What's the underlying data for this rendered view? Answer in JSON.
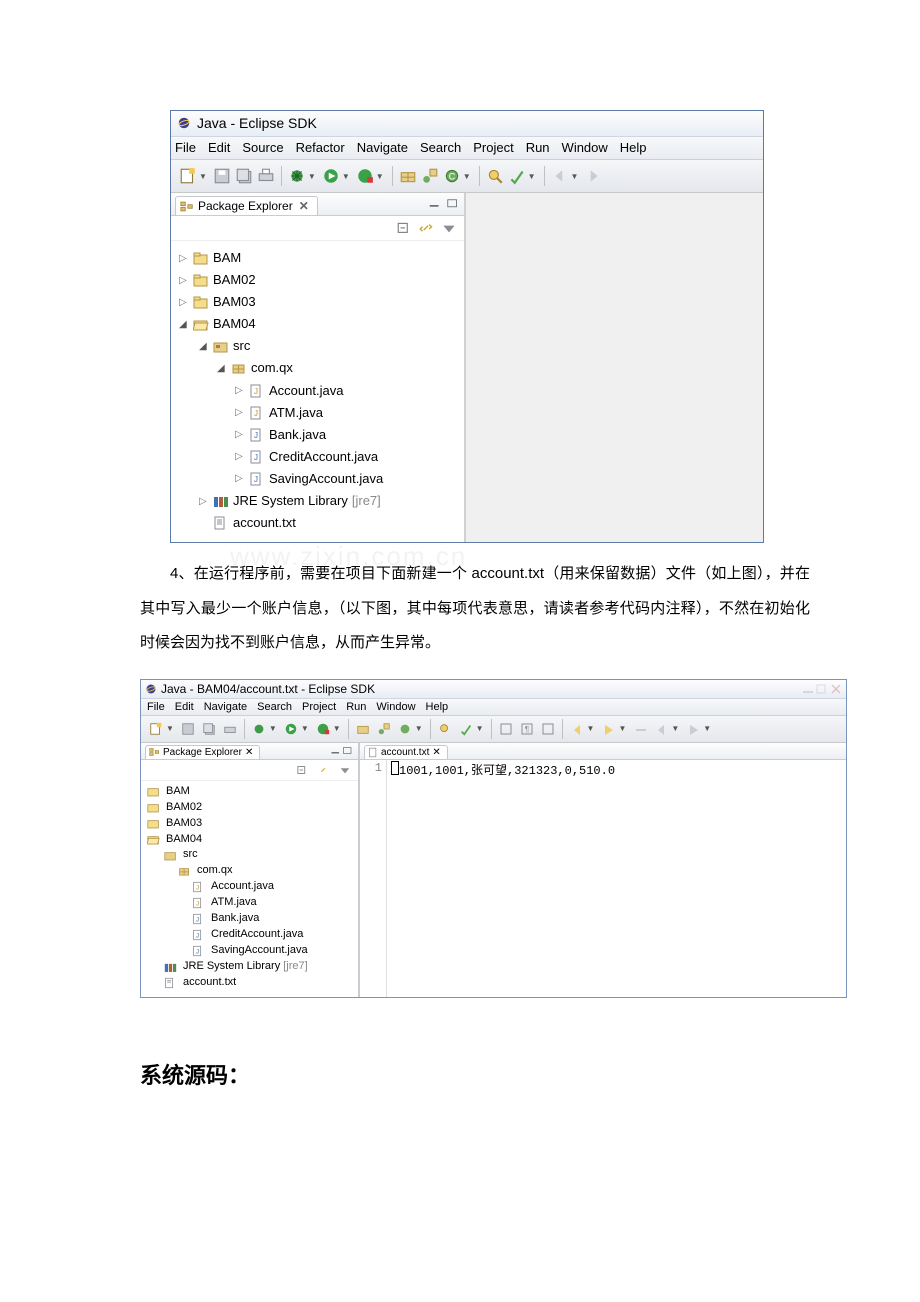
{
  "eclipse1": {
    "title": "Java - Eclipse SDK",
    "menu": [
      "File",
      "Edit",
      "Source",
      "Refactor",
      "Navigate",
      "Search",
      "Project",
      "Run",
      "Window",
      "Help"
    ],
    "package_explorer_tab": "Package Explorer",
    "tree": {
      "p1": "BAM",
      "p2": "BAM02",
      "p3": "BAM03",
      "p4": "BAM04",
      "src": "src",
      "pkg": "com.qx",
      "f1": "Account.java",
      "f2": "ATM.java",
      "f3": "Bank.java",
      "f4": "CreditAccount.java",
      "f5": "SavingAccount.java",
      "jre": "JRE System Library",
      "jre_ver": "[jre7]",
      "txt": "account.txt"
    }
  },
  "watermark": "www.zixin.com.cn",
  "paragraph": "4、在运行程序前，需要在项目下面新建一个 account.txt（用来保留数据）文件（如上图），并在其中写入最少一个账户信息，（以下图，其中每项代表意思，请读者参考代码内注释），不然在初始化时候会因为找不到账户信息，从而产生异常。",
  "eclipse2": {
    "title": "Java - BAM04/account.txt - Eclipse SDK",
    "menu": [
      "File",
      "Edit",
      "Navigate",
      "Search",
      "Project",
      "Run",
      "Window",
      "Help"
    ],
    "editor_tab": "account.txt",
    "line_no": "1",
    "file_content": "1001,1001,张可望,321323,0,510.0"
  },
  "source_heading": "系统源码："
}
